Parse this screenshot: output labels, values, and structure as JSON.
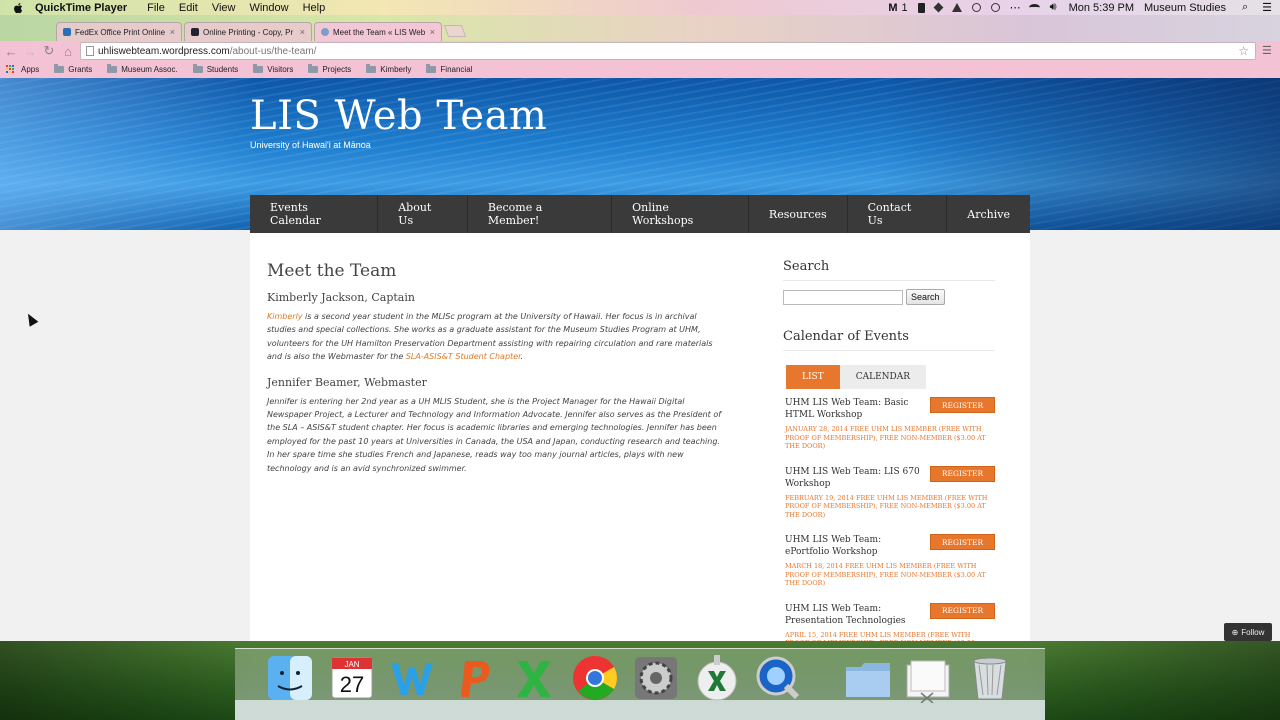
{
  "menubar": {
    "app_name": "QuickTime Player",
    "menus": [
      "File",
      "Edit",
      "View",
      "Window",
      "Help"
    ],
    "badge": "1",
    "clock": "Mon 5:39 PM",
    "user": "Museum Studies"
  },
  "browser": {
    "tabs": [
      {
        "label": "FedEx Office Print Online",
        "color": "#2b6fb3"
      },
      {
        "label": "Online Printing - Copy, Pr",
        "color": "#223"
      },
      {
        "label": "Meet the Team « LIS Web",
        "color": "#7aa0c8"
      }
    ],
    "url_host": "uhliswebteam.wordpress.com",
    "url_path": "/about-us/the-team/",
    "bookmarks": [
      "Apps",
      "Grants",
      "Museum Assoc.",
      "Students",
      "Visitors",
      "Projects",
      "Kimberly",
      "Financial"
    ]
  },
  "site": {
    "title": "LIS Web Team",
    "description": "University of Hawai'i at Mānoa",
    "nav": [
      "Events Calendar",
      "About Us",
      "Become a Member!",
      "Online Workshops",
      "Resources",
      "Contact Us",
      "Archive"
    ]
  },
  "article": {
    "title": "Meet the Team",
    "members": [
      {
        "name": "Kimberly Jackson, Captain",
        "link_text": "Kimberly",
        "bio_a": " is a second year student in the MLISc program at the University of Hawaii. Her focus is in archival studies and special collections. She works as a graduate assistant for the Museum Studies Program at UHM, volunteers for the UH Hamilton Preservation Department assisting with repairing circulation and rare materials and is also the Webmaster for the ",
        "bio_link": "SLA-ASIS&T Student Chapter",
        "bio_b": "."
      },
      {
        "name": "Jennifer Beamer, Webmaster",
        "bio": "Jennifer is entering her 2nd year as a UH MLIS Student, she is the Project Manager for the Hawaii Digital Newspaper Project, a Lecturer and Technology and Information Advocate. Jennifer also serves as the President of the SLA – ASIS&T student chapter. Her focus is academic libraries and emerging technologies. Jennifer has been employed for the past 10 years at Universities in Canada, the USA and Japan, conducting research and teaching.  In her spare time she studies French and Japanese, reads way too many journal articles, plays with new technology and is an avid synchronized swimmer."
      }
    ]
  },
  "sidebar": {
    "search_title": "Search",
    "search_button": "Search",
    "search_value": "",
    "calendar_title": "Calendar of Events",
    "view_tabs": [
      "LIST",
      "CALENDAR"
    ],
    "register_label": "REGISTER",
    "events": [
      {
        "title": "UHM LIS Web Team: Basic HTML Workshop",
        "meta": "January 28, 2014 FREE UHM LIS MEMBER (FREE WITH PROOF OF MEMBERSHIP), FREE NON-MEMBER ($3.00 AT THE DOOR)"
      },
      {
        "title": "UHM LIS Web Team: LIS 670 Workshop",
        "meta": "February 19, 2014 FREE UHM LIS MEMBER (FREE WITH PROOF OF MEMBERSHIP), FREE NON-MEMBER ($3.00 AT THE DOOR)"
      },
      {
        "title": "UHM LIS Web Team: ePortfolio Workshop",
        "meta": "March 18, 2014 FREE UHM LIS MEMBER (FREE WITH PROOF OF MEMBERSHIP), FREE NON-MEMBER ($3.00 AT THE DOOR)"
      },
      {
        "title": "UHM LIS Web Team: Presentation Technologies",
        "meta": "April 15, 2014 FREE UHM LIS MEMBER (FREE WITH PROOF OF MEMBERSHIP), FREE NON-MEMBER ($3.00"
      }
    ]
  },
  "follow_label": "Follow",
  "dock": {
    "calendar_month": "JAN",
    "calendar_day": "27",
    "icons": [
      "finder-icon",
      "calendar-icon",
      "word-icon",
      "powerpoint-icon",
      "excel-icon",
      "chrome-icon",
      "system-preferences-icon",
      "excel-download-icon",
      "quicktime-icon",
      "documents-folder-icon",
      "document-stack-icon",
      "trash-icon"
    ]
  },
  "colors": {
    "accent": "#e8772e",
    "nav_bg": "#3a3a3a",
    "banner_blue": "#1f7fd0"
  }
}
